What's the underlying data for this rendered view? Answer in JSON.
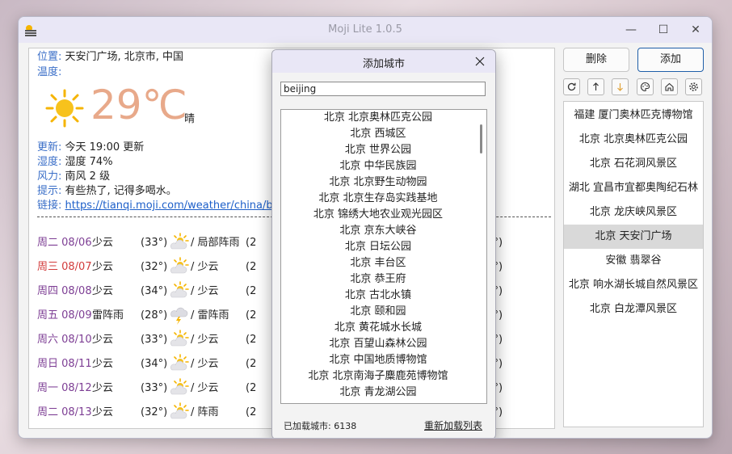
{
  "window": {
    "title": "Moji Lite 1.0.5",
    "minimize": "—",
    "maximize": "☐",
    "close": "✕"
  },
  "weather": {
    "location_label": "位置:",
    "location_value": "天安门广场, 北京市, 中国",
    "temp_label": "温度:",
    "temperature": "29℃",
    "condition": "晴",
    "update_label": "更新:",
    "update_value": "今天 19:00 更新",
    "humidity_label": "湿度:",
    "humidity_value": "湿度 74%",
    "wind_label": "风力:",
    "wind_value": "南风 2 级",
    "tip_label": "提示:",
    "tip_value": "有些热了, 记得多喝水。",
    "link_label": "链接:",
    "link_value": "https://tianqi.moji.com/weather/china/beijing/tiananmen-square",
    "divider": "- - - - - - - - - - - - - - - - - - - - - - - - - - - - - - - - - - - - - - - - - - - - - - - - - - - - - - - - - - - - - - - - - - - - - - - - - - - - - - - - - - - - - - - - - -"
  },
  "forecast": [
    {
      "day": "周二 08/06",
      "day_cond": "少云",
      "high": "(33°)",
      "icon": "partly-cloudy-icon",
      "night_cond": "/ 局部阵雨",
      "low": "(2",
      "low_right": "23°)",
      "highlight": false
    },
    {
      "day": "周三 08/07",
      "day_cond": "少云",
      "high": "(32°)",
      "icon": "partly-cloudy-icon",
      "night_cond": "/ 少云",
      "low": "(2",
      "low_right": "23°)",
      "highlight": true
    },
    {
      "day": "周四 08/08",
      "day_cond": "少云",
      "high": "(34°)",
      "icon": "partly-cloudy-icon",
      "night_cond": "/ 少云",
      "low": "(2",
      "low_right": "23°)",
      "highlight": false
    },
    {
      "day": "周五 08/09",
      "day_cond": "雷阵雨",
      "high": "(28°)",
      "icon": "thunderstorm-icon",
      "night_cond": "/ 雷阵雨",
      "low": "(2",
      "low_right": "23°)",
      "highlight": false
    },
    {
      "day": "周六 08/10",
      "day_cond": "少云",
      "high": "(33°)",
      "icon": "partly-cloudy-icon",
      "night_cond": "/ 少云",
      "low": "(2",
      "low_right": "23°)",
      "highlight": false
    },
    {
      "day": "周日 08/11",
      "day_cond": "少云",
      "high": "(34°)",
      "icon": "partly-cloudy-icon",
      "night_cond": "/ 少云",
      "low": "(2",
      "low_right": "23°)",
      "highlight": false
    },
    {
      "day": "周一 08/12",
      "day_cond": "少云",
      "high": "(33°)",
      "icon": "partly-cloudy-icon",
      "night_cond": "/ 少云",
      "low": "(2",
      "low_right": "22°)",
      "highlight": false
    },
    {
      "day": "周二 08/13",
      "day_cond": "少云",
      "high": "(32°)",
      "icon": "partly-cloudy-icon",
      "night_cond": "/ 阵雨",
      "low": "(2",
      "low_right": "23°)",
      "highlight": false
    }
  ],
  "right": {
    "delete_label": "删除",
    "add_label": "添加",
    "tools": [
      "refresh-icon",
      "move-up-icon",
      "move-down-icon",
      "palette-icon",
      "home-icon",
      "settings-icon"
    ],
    "cities": [
      "福建 厦门奥林匹克博物馆",
      "北京 北京奥林匹克公园",
      "北京 石花洞风景区",
      "湖北 宜昌市宜都奥陶纪石林",
      "北京 龙庆峡风景区",
      "北京 天安门广场",
      "安徽 翡翠谷",
      "北京 响水湖长城自然风景区",
      "北京 白龙潭风景区"
    ],
    "selected_index": 5
  },
  "dialog": {
    "title": "添加城市",
    "search_value": "beijing",
    "results": [
      "北京 北京奥林匹克公园",
      "北京 西城区",
      "北京 世界公园",
      "北京 中华民族园",
      "北京 北京野生动物园",
      "北京 北京生存岛实践基地",
      "北京 锦绣大地农业观光园区",
      "北京 京东大峡谷",
      "北京 日坛公园",
      "北京 丰台区",
      "北京 恭王府",
      "北京 古北水镇",
      "北京 颐和园",
      "北京 黄花城水长城",
      "北京 百望山森林公园",
      "北京 中国地质博物馆",
      "北京 北京南海子麋鹿苑博物馆",
      "北京 青龙湖公园"
    ],
    "loaded_label": "已加载城市:  6138",
    "reload_label": "重新加载列表"
  },
  "colors": {
    "accent_border": "#1f5fa8",
    "label_blue": "#3b6fc8",
    "weekday_purple": "#7d3e94",
    "weekday_red": "#d23b3b",
    "temp_orange": "#e8a98a"
  }
}
